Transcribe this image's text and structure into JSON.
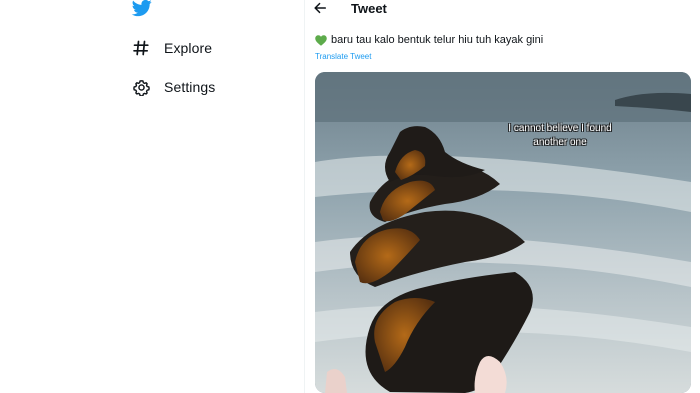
{
  "sidebar": {
    "logo_icon": "twitter-bird-icon",
    "brand_color": "#1d9bf0",
    "items": [
      {
        "label": "Explore",
        "icon": "hashtag-icon"
      },
      {
        "label": "Settings",
        "icon": "gear-icon"
      }
    ]
  },
  "header": {
    "back_icon": "arrow-left-icon",
    "title": "Tweet"
  },
  "tweet": {
    "emoji": "green-heart-icon",
    "text": "baru tau kalo bentuk telur hiu tuh kayak gini",
    "translate_label": "Translate Tweet",
    "link_color": "#1d9bf0"
  },
  "media": {
    "caption": "I cannot believe I found another one"
  }
}
